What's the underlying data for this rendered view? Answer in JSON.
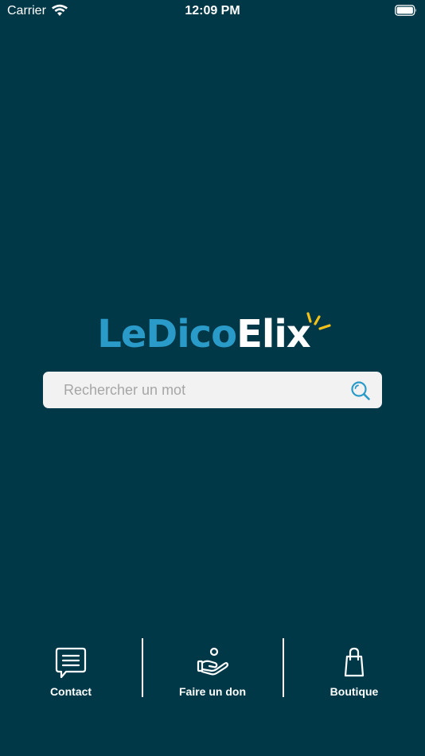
{
  "status_bar": {
    "carrier": "Carrier",
    "time": "12:09 PM"
  },
  "logo": {
    "part1": "Le",
    "part2": "Dico",
    "part3": "Elix"
  },
  "search": {
    "placeholder": "Rechercher un mot",
    "value": ""
  },
  "bottom_nav": {
    "items": [
      {
        "label": "Contact",
        "icon": "chat-icon"
      },
      {
        "label": "Faire un don",
        "icon": "donate-hand-icon"
      },
      {
        "label": "Boutique",
        "icon": "shopping-bag-icon"
      }
    ]
  },
  "colors": {
    "background": "#003848",
    "accent_blue": "#2a9bc8",
    "ray_yellow": "#f2c21a",
    "search_bg": "#f2f2f2"
  }
}
